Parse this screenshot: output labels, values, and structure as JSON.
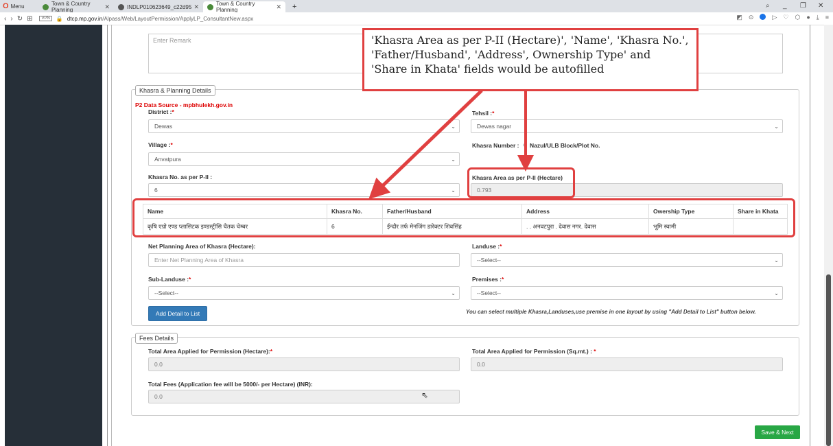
{
  "browser": {
    "menu_label": "Menu",
    "tabs": [
      {
        "title": "Town & Country Planning",
        "active": false
      },
      {
        "title": "INDLP010623649_c22d95",
        "active": false
      },
      {
        "title": "Town & Country Planning",
        "active": true
      }
    ],
    "new_tab": "+",
    "url_host": "dtcp.mp.gov.in",
    "url_path": "/Alpass/Web/LayoutPermission/ApplyLP_ConsultantNew.aspx",
    "vpn_label": "VPN"
  },
  "remark": {
    "placeholder": "Enter Remark"
  },
  "khasra_section": {
    "legend": "Khasra & Planning Details",
    "data_source": "P2 Data Source - mpbhulekh.gov.in",
    "district_label": "District :",
    "district_value": "Dewas",
    "tehsil_label": "Tehsil :",
    "tehsil_value": "Dewas nagar",
    "village_label": "Village :",
    "village_value": "Anvatpura",
    "khasra_number_label": "Khasra Number :",
    "nazul_label": "Nazul/ULB Block/Plot No.",
    "khasra_no_label": "Khasra No. as per P-II :",
    "khasra_no_value": "6",
    "khasra_area_label": "Khasra Area as per P-II (Hectare)",
    "khasra_area_value": "0.793",
    "table_headers": [
      "Name",
      "Khasra No.",
      "Father/Husband",
      "Address",
      "Owership Type",
      "Share in Khata"
    ],
    "table_rows": [
      [
        "कृषि एग्रो एण्ड प्लासिटक इण्डस्ट्रीसि चैतक चेम्बर",
        "6",
        "ईन्दौर तर्फ मेनजिंग डारेक्टर शिवसिंह",
        ". . अनवटपुरा . देवास नगर. देवास",
        "भूमि स्वामी",
        ""
      ]
    ],
    "net_area_label": "Net Planning Area of Khasra (Hectare):",
    "net_area_placeholder": "Enter Net Planning Area of Khasra",
    "landuse_label": "Landuse :",
    "landuse_value": "--Select--",
    "sublanduse_label": "Sub-Landuse :",
    "sublanduse_value": "--Select--",
    "premises_label": "Premises :",
    "premises_value": "--Select--",
    "add_button": "Add Detail to List",
    "note": "You can select multiple Khasra,Landuses,use premise in one layout by using \"Add Detail to List\" button below."
  },
  "fees_section": {
    "legend": "Fees Details",
    "total_area_ha_label": "Total Area Applied for Permission (Hectare):",
    "total_area_ha_value": "0.0",
    "total_area_sqm_label": "Total Area Applied for Permission (Sq.mt.) :",
    "total_area_sqm_value": "0.0",
    "total_fees_label": "Total Fees (Application fee will be 5000/- per Hectare) (INR):",
    "total_fees_value": "0.0"
  },
  "save_button": "Save & Next",
  "callout_text": "'Khasra Area as per P-II (Hectare)', 'Name', 'Khasra No.', 'Father/Husband', 'Address', Ownership Type' and 'Share in Khata' fields would be autofilled",
  "colors": {
    "annotation": "#e04040",
    "primary": "#337ab7",
    "success": "#28a745",
    "required": "#dd0000"
  }
}
